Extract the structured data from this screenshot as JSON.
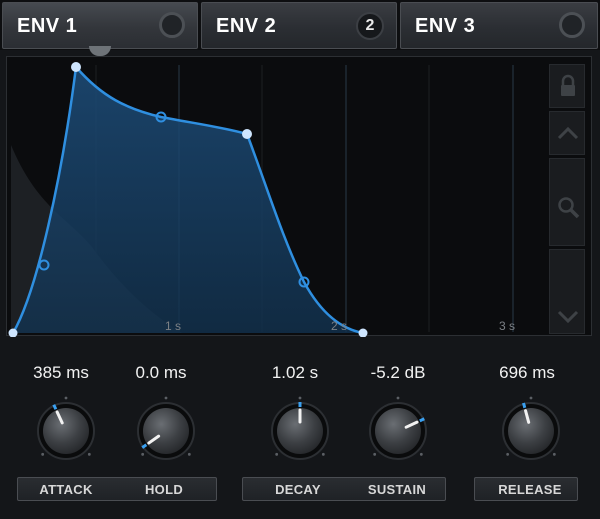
{
  "tabs": [
    {
      "label": "ENV 1",
      "active": true,
      "indicator": "ring"
    },
    {
      "label": "ENV 2",
      "active": false,
      "indicator": "badge",
      "badge": "2"
    },
    {
      "label": "ENV 3",
      "active": false,
      "indicator": "ring"
    }
  ],
  "graph": {
    "time_labels": [
      "1 s",
      "2 s",
      "3 s"
    ],
    "curve_color": "#2f8fe0",
    "fill_color": "#163a5c"
  },
  "sidebar": {
    "icons": [
      "lock-icon",
      "chevron-up-icon",
      "magnifier-icon",
      "chevron-down-icon"
    ]
  },
  "knobs": {
    "attack": {
      "label": "ATTACK",
      "value": "385 ms",
      "angle_deg": -25
    },
    "hold": {
      "label": "HOLD",
      "value": "0.0 ms",
      "angle_deg": -125
    },
    "decay": {
      "label": "DECAY",
      "value": "1.02 s",
      "angle_deg": 0
    },
    "sustain": {
      "label": "SUSTAIN",
      "value": "-5.2 dB",
      "angle_deg": 65
    },
    "release": {
      "label": "RELEASE",
      "value": "696 ms",
      "angle_deg": -15
    }
  },
  "colors": {
    "accent": "#2f8fe0",
    "indicator": "#3aa0f0"
  }
}
